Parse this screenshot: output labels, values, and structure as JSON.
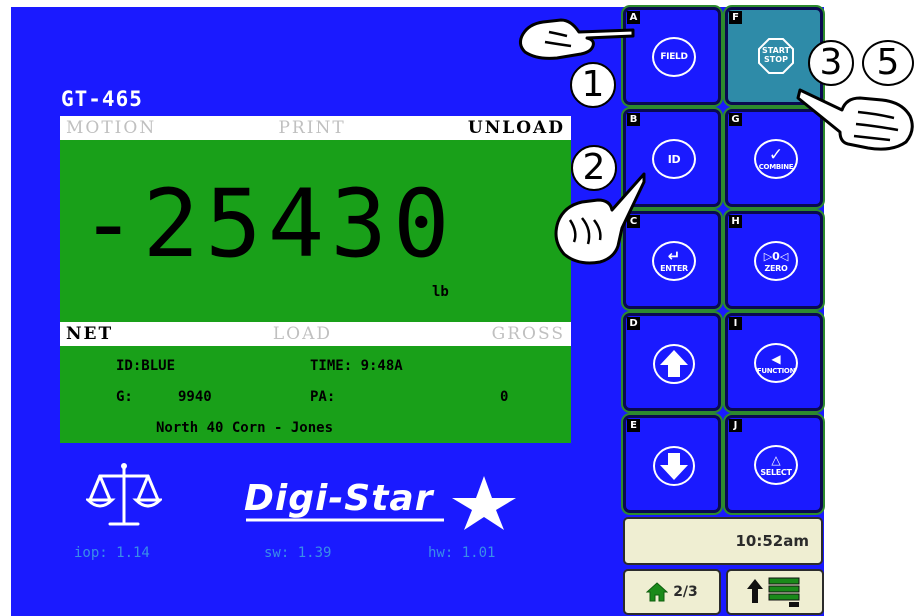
{
  "device": {
    "model": "GT-465",
    "brand": "Digi-Star"
  },
  "top_status": {
    "motion": "MOTION",
    "print": "PRINT",
    "unload": "UNLOAD"
  },
  "weight": {
    "value": "-25430",
    "unit": "lb"
  },
  "bottom_status": {
    "net": "NET",
    "load": "LOAD",
    "gross": "GROSS"
  },
  "info": {
    "id": "ID:BLUE",
    "time": "TIME: 9:48A",
    "g_label": "G:",
    "g_value": "9940",
    "pa_label": "PA:",
    "pa_value": "0",
    "field": "North 40 Corn - Jones"
  },
  "versions": {
    "iop": "iop: 1.14",
    "sw": "sw: 1.39",
    "hw": "hw: 1.01"
  },
  "softkeys": [
    {
      "letter": "A",
      "label": "FIELD",
      "icon": "field-text"
    },
    {
      "letter": "B",
      "label": "ID",
      "icon": "id-text"
    },
    {
      "letter": "C",
      "label": "ENTER",
      "icon": "enter-arrow-icon"
    },
    {
      "letter": "D",
      "label": "",
      "icon": "up-arrow-icon"
    },
    {
      "letter": "E",
      "label": "",
      "icon": "down-arrow-icon"
    },
    {
      "letter": "F",
      "label_line1": "START",
      "label_line2": "STOP",
      "icon": "start-stop-icon",
      "active": true
    },
    {
      "letter": "G",
      "label": "COMBINE",
      "icon": "checkmark-icon"
    },
    {
      "letter": "H",
      "label": "ZERO",
      "glyph": "▷0◁",
      "icon": "zero-icon"
    },
    {
      "letter": "I",
      "label": "FUNCTION",
      "glyph": "◀",
      "icon": "function-arrow-icon"
    },
    {
      "letter": "J",
      "label": "SELECT",
      "glyph": "△",
      "icon": "select-triangle-icon"
    }
  ],
  "clock": "10:52am",
  "home_button": {
    "label": "2/3",
    "icon": "home-icon"
  },
  "menu_button": {
    "icon": "up-arrow-menu-icon"
  },
  "callouts": {
    "one": "1",
    "two": "2",
    "three": "3",
    "five": "5"
  },
  "colors": {
    "screen": "#1a1aff",
    "panel": "#19a019",
    "active_key": "#2e8ba8",
    "version_text": "#3a8ee8"
  }
}
